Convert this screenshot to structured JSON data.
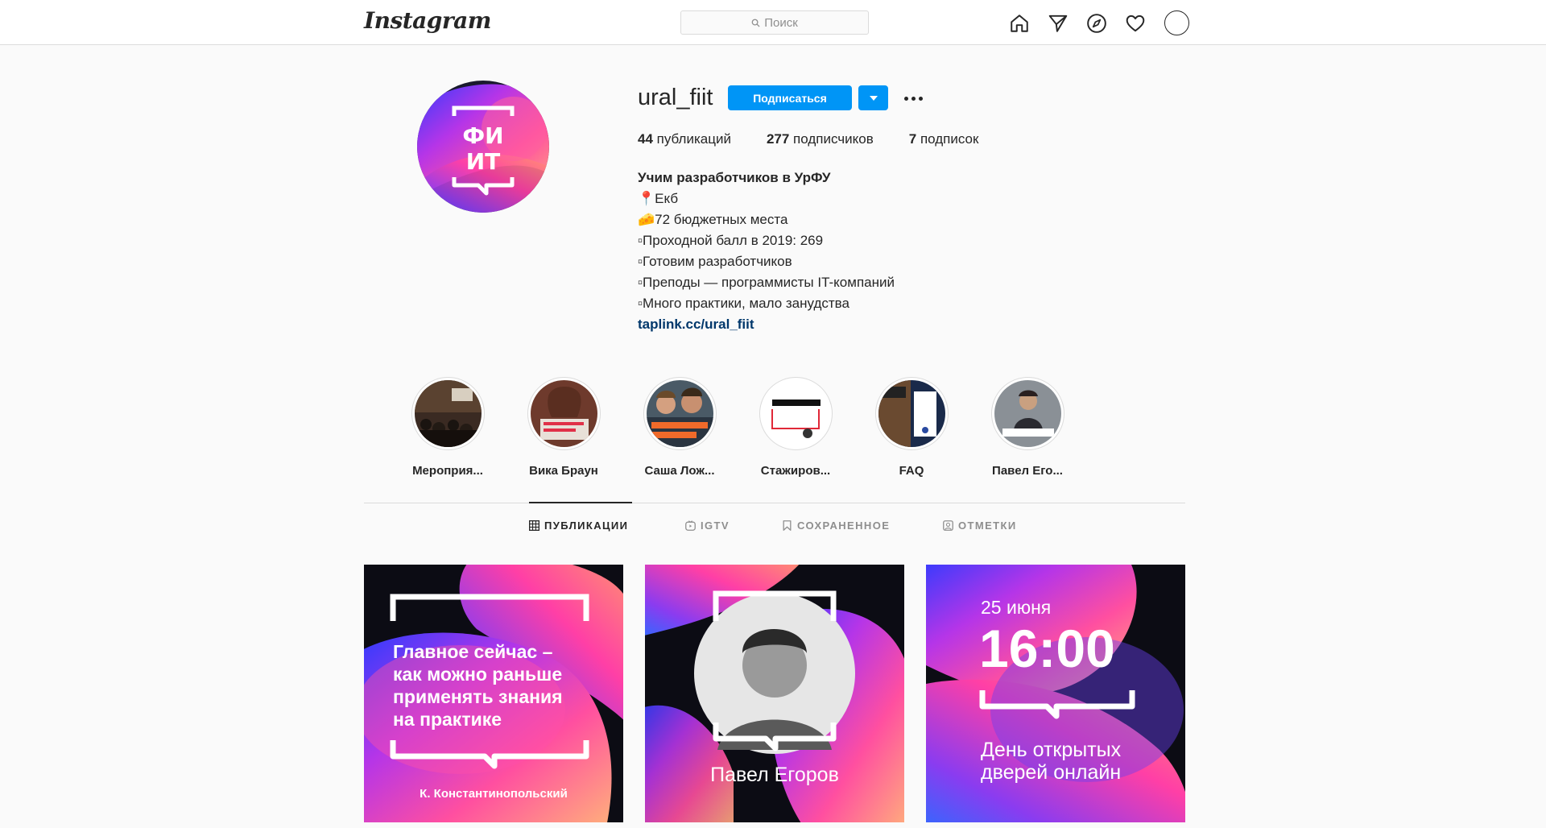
{
  "brand": {
    "logo_text": "Instagram"
  },
  "search": {
    "placeholder": "Поиск"
  },
  "nav_icons": [
    "home-icon",
    "direct-icon",
    "explore-icon",
    "activity-heart-icon",
    "profile-avatar"
  ],
  "profile": {
    "username": "ural_fiit",
    "follow_label": "Подписаться",
    "stats": [
      {
        "count": "44",
        "label": "публикаций"
      },
      {
        "count": "277",
        "label": "подписчиков"
      },
      {
        "count": "7",
        "label": "подписок"
      }
    ],
    "bio": {
      "name": "Учим разработчиков в УрФУ",
      "lines": [
        "📍Екб",
        "🧀72 бюджетных места",
        "▫Проходной балл в 2019: 269",
        "▫Готовим разработчиков",
        "▫Преподы — программисты IT-компаний",
        "▫Много практики, мало занудства"
      ],
      "link": "taplink.cc/ural_fiit"
    }
  },
  "highlights": [
    {
      "label": "Мероприя..."
    },
    {
      "label": "Вика Браун"
    },
    {
      "label": "Саша Лож..."
    },
    {
      "label": "Стажиров..."
    },
    {
      "label": "FAQ"
    },
    {
      "label": "Павел Его..."
    }
  ],
  "tabs": [
    {
      "label": "ПУБЛИКАЦИИ",
      "icon": "grid-icon",
      "active": true
    },
    {
      "label": "IGTV",
      "icon": "igtv-icon",
      "active": false
    },
    {
      "label": "СОХРАНЕННОЕ",
      "icon": "bookmark-icon",
      "active": false
    },
    {
      "label": "ОТМЕТКИ",
      "icon": "tagged-icon",
      "active": false
    }
  ],
  "posts": [
    {
      "quote_lines": [
        "Главное сейчас –",
        "как можно раньше",
        "применять знания",
        "на практике"
      ],
      "author": "К. Константинопольский"
    },
    {
      "name": "Павел Егоров"
    },
    {
      "date": "25 июня",
      "time": "16:00",
      "caption_lines": [
        "День открытых",
        "дверей онлайн"
      ]
    }
  ],
  "colors": {
    "primary_blue": "#0095f6",
    "link_blue": "#00376b",
    "text": "#262626",
    "muted": "#8e8e8e",
    "border": "#dbdbdb"
  }
}
